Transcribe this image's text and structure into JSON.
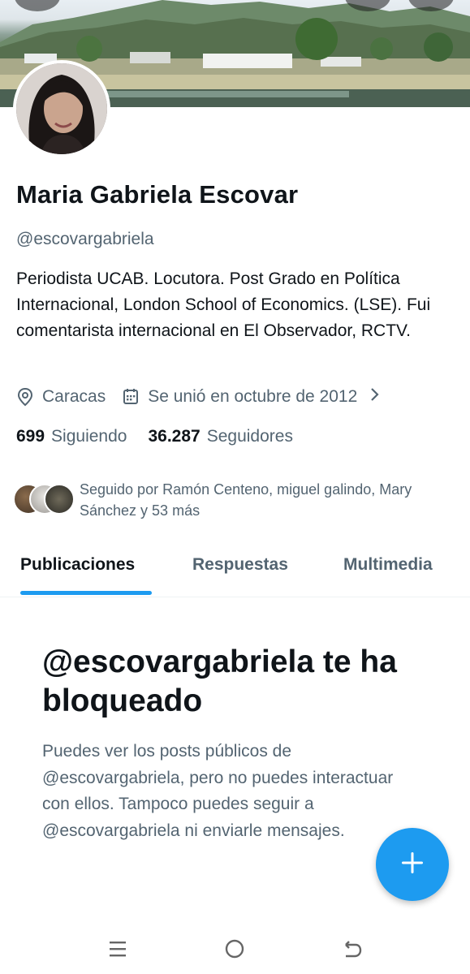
{
  "profile": {
    "name": "Maria Gabriela Escovar",
    "handle": "@escovargabriela",
    "bio": "Periodista UCAB. Locutora. Post Grado en Política Internacional, London School of Economics. (LSE). Fui comentarista internacional en El Observador, RCTV.",
    "location": "Caracas",
    "joined": "Se unió en octubre de 2012",
    "following_count": "699",
    "following_label": "Siguiendo",
    "followers_count": "36.287",
    "followers_label": "Seguidores",
    "followed_by": "Seguido por Ramón Centeno, miguel galindo, Mary Sánchez y 53 más"
  },
  "tabs": [
    {
      "label": "Publicaciones",
      "active": true
    },
    {
      "label": "Respuestas",
      "active": false
    },
    {
      "label": "Multimedia",
      "active": false
    }
  ],
  "blocked": {
    "title": "@escovargabriela te ha bloqueado",
    "description": "Puedes ver los posts públicos de @escovargabriela, pero no puedes interactuar con ellos. Tampoco puedes seguir a @escovargabriela ni enviarle mensajes."
  },
  "icons": {
    "location": "location-pin-icon",
    "calendar": "calendar-icon",
    "chevron": "chevron-right-icon",
    "fab": "plus-icon",
    "nav_recent": "recent-apps-icon",
    "nav_home": "home-circle-icon",
    "nav_back": "back-arrow-icon"
  },
  "colors": {
    "accent": "#1d9bf0",
    "text_primary": "#0f1419",
    "text_secondary": "#536471"
  }
}
